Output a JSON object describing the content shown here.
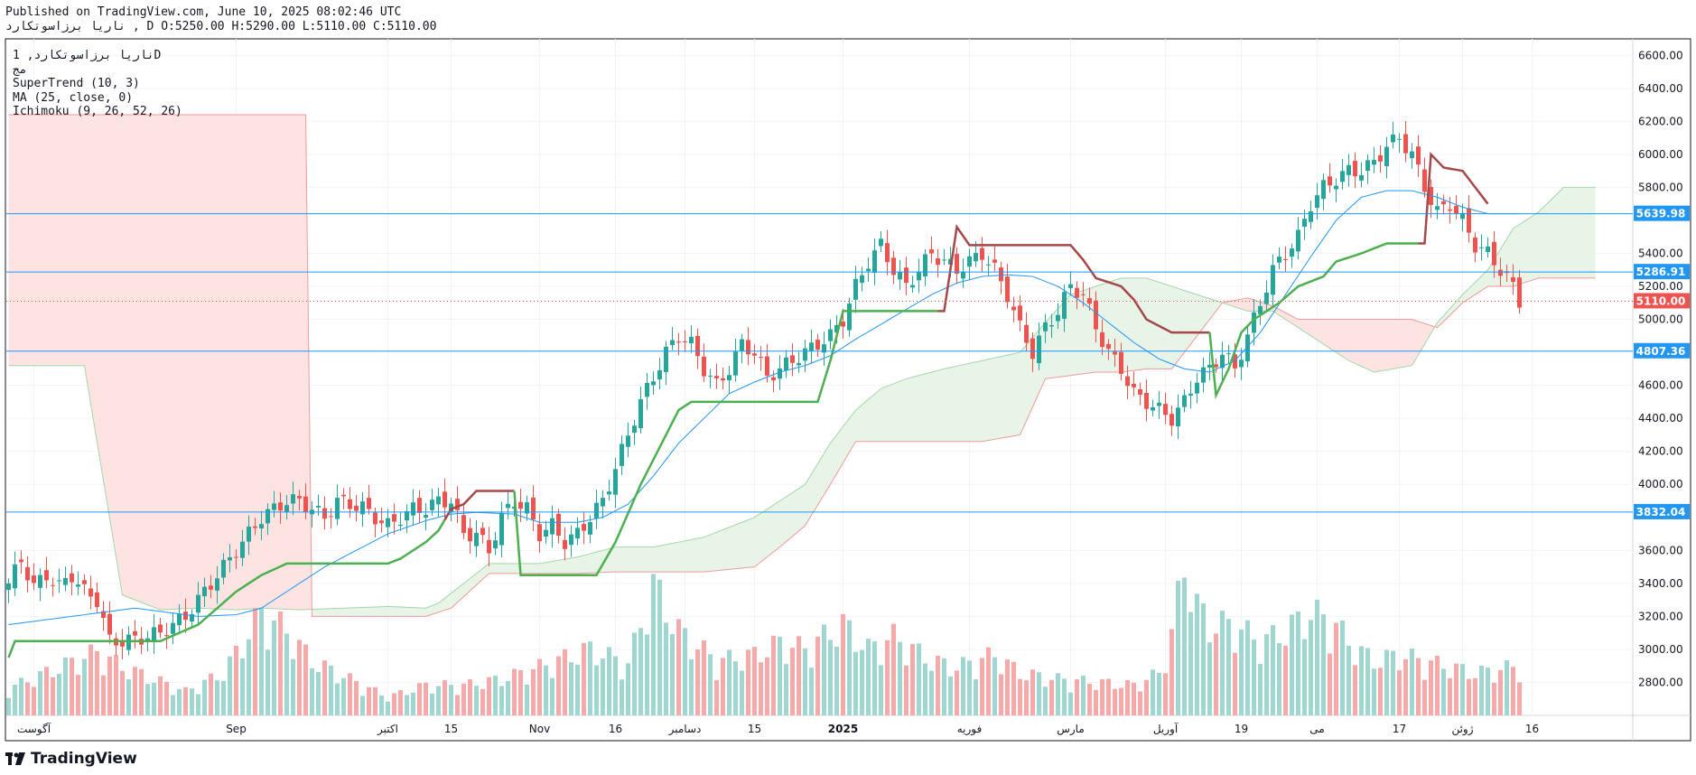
{
  "header": {
    "published": "Published on TradingView.com, June 10, 2025 08:02:46 UTC",
    "ohlc": "ناریا برزاسوتکارد , D O:5250.00 H:5290.00 L:5110.00 C:5110.00"
  },
  "legend": {
    "symbol_line": "ناریا برزاسوتکارد, 1D",
    "line2": "مج",
    "supertrend": "SuperTrend (10, 3)",
    "ma": "MA (25, close, 0)",
    "ichimoku": "Ichimoku (9, 26, 52, 26)"
  },
  "footer": {
    "brand": "TradingView"
  },
  "colors": {
    "up": "#26a69a",
    "down": "#ef5350",
    "vol_up": "#9fd6cf",
    "vol_down": "#f6a9a9",
    "supertrend_up": "#4caf50",
    "supertrend_down": "#a54849",
    "ma": "#2196f3",
    "cloud_bull": "#e7f4e7",
    "cloud_bear": "#fde4e3",
    "hline": "#2196f3",
    "grid": "#f0f3fa"
  },
  "chart_data": {
    "type": "candlestick",
    "ylim": [
      2600,
      6700
    ],
    "y_ticks": [
      "6600.00",
      "6400.00",
      "6200.00",
      "6000.00",
      "5800.00",
      "5400.00",
      "5200.00",
      "5000.00",
      "4600.00",
      "4400.00",
      "4200.00",
      "4000.00",
      "3600.00",
      "3400.00",
      "3200.00",
      "3000.00",
      "2800.00"
    ],
    "x_labels": [
      "آگوست",
      "Sep",
      "اکتبر",
      "15",
      "Nov",
      "16",
      "دسامبر",
      "15",
      "2025",
      "فوریه",
      "مارس",
      "آوریل",
      "19",
      "می",
      "17",
      "ژوئن",
      "16"
    ],
    "x_label_idx": [
      4,
      36,
      60,
      70,
      84,
      96,
      107,
      118,
      132,
      152,
      168,
      183,
      195,
      207,
      220,
      230,
      241
    ],
    "h_levels": [
      {
        "value": 5639.98,
        "label": "5639.98"
      },
      {
        "value": 5286.91,
        "label": "5286.91"
      },
      {
        "value": 4807.36,
        "label": "4807.36"
      },
      {
        "value": 3832.04,
        "label": "3832.04"
      }
    ],
    "last_price": {
      "value": 5110.0,
      "label": "5110.00"
    },
    "anchors": [
      [
        0,
        3400
      ],
      [
        2,
        3540
      ],
      [
        4,
        3380
      ],
      [
        6,
        3450
      ],
      [
        8,
        3380
      ],
      [
        10,
        3450
      ],
      [
        12,
        3350
      ],
      [
        14,
        3300
      ],
      [
        16,
        3050
      ],
      [
        18,
        3050
      ],
      [
        20,
        3060
      ],
      [
        22,
        3080
      ],
      [
        24,
        3100
      ],
      [
        26,
        3150
      ],
      [
        28,
        3200
      ],
      [
        30,
        3300
      ],
      [
        32,
        3400
      ],
      [
        34,
        3500
      ],
      [
        36,
        3600
      ],
      [
        38,
        3700
      ],
      [
        40,
        3800
      ],
      [
        42,
        3850
      ],
      [
        44,
        3900
      ],
      [
        46,
        3900
      ],
      [
        48,
        3850
      ],
      [
        50,
        3800
      ],
      [
        52,
        3900
      ],
      [
        54,
        3880
      ],
      [
        56,
        3860
      ],
      [
        58,
        3800
      ],
      [
        60,
        3750
      ],
      [
        62,
        3800
      ],
      [
        64,
        3850
      ],
      [
        66,
        3850
      ],
      [
        68,
        3900
      ],
      [
        70,
        3900
      ],
      [
        72,
        3700
      ],
      [
        74,
        3700
      ],
      [
        76,
        3600
      ],
      [
        78,
        3800
      ],
      [
        80,
        3900
      ],
      [
        82,
        3850
      ],
      [
        84,
        3700
      ],
      [
        86,
        3750
      ],
      [
        88,
        3650
      ],
      [
        90,
        3700
      ],
      [
        92,
        3800
      ],
      [
        94,
        3900
      ],
      [
        96,
        4100
      ],
      [
        98,
        4300
      ],
      [
        100,
        4500
      ],
      [
        102,
        4650
      ],
      [
        104,
        4800
      ],
      [
        106,
        4900
      ],
      [
        108,
        4850
      ],
      [
        110,
        4700
      ],
      [
        112,
        4600
      ],
      [
        114,
        4700
      ],
      [
        116,
        4850
      ],
      [
        118,
        4800
      ],
      [
        120,
        4650
      ],
      [
        122,
        4700
      ],
      [
        124,
        4750
      ],
      [
        126,
        4800
      ],
      [
        128,
        4850
      ],
      [
        130,
        4900
      ],
      [
        132,
        5000
      ],
      [
        134,
        5200
      ],
      [
        136,
        5350
      ],
      [
        138,
        5450
      ],
      [
        140,
        5300
      ],
      [
        142,
        5200
      ],
      [
        144,
        5300
      ],
      [
        146,
        5400
      ],
      [
        148,
        5350
      ],
      [
        150,
        5300
      ],
      [
        152,
        5350
      ],
      [
        154,
        5400
      ],
      [
        156,
        5300
      ],
      [
        158,
        5150
      ],
      [
        160,
        4950
      ],
      [
        162,
        4800
      ],
      [
        164,
        4950
      ],
      [
        166,
        5050
      ],
      [
        168,
        5200
      ],
      [
        170,
        5150
      ],
      [
        172,
        4950
      ],
      [
        174,
        4800
      ],
      [
        176,
        4700
      ],
      [
        178,
        4550
      ],
      [
        180,
        4500
      ],
      [
        182,
        4450
      ],
      [
        184,
        4400
      ],
      [
        186,
        4500
      ],
      [
        188,
        4650
      ],
      [
        190,
        4700
      ],
      [
        192,
        4800
      ],
      [
        194,
        4700
      ],
      [
        196,
        4900
      ],
      [
        198,
        5100
      ],
      [
        200,
        5300
      ],
      [
        202,
        5400
      ],
      [
        204,
        5500
      ],
      [
        206,
        5700
      ],
      [
        208,
        5800
      ],
      [
        210,
        5850
      ],
      [
        212,
        5900
      ],
      [
        214,
        5900
      ],
      [
        216,
        5950
      ],
      [
        218,
        6050
      ],
      [
        220,
        6100
      ],
      [
        222,
        6000
      ],
      [
        224,
        5800
      ],
      [
        226,
        5650
      ],
      [
        228,
        5700
      ],
      [
        230,
        5600
      ],
      [
        232,
        5450
      ],
      [
        234,
        5400
      ],
      [
        236,
        5300
      ],
      [
        238,
        5200
      ],
      [
        239,
        5110
      ]
    ],
    "supertrend": [
      [
        0,
        2950
      ],
      [
        1,
        3050
      ],
      [
        12,
        3050
      ],
      [
        24,
        3050
      ],
      [
        30,
        3150
      ],
      [
        36,
        3350
      ],
      [
        40,
        3450
      ],
      [
        44,
        3520
      ],
      [
        56,
        3520
      ],
      [
        60,
        3520
      ],
      [
        62,
        3550
      ],
      [
        66,
        3650
      ],
      [
        68,
        3720
      ],
      [
        70,
        3850
      ],
      [
        72,
        3880
      ],
      [
        74,
        3960
      ],
      [
        80,
        3960
      ],
      [
        81,
        3450
      ],
      [
        93,
        3450
      ],
      [
        96,
        3650
      ],
      [
        100,
        4000
      ],
      [
        104,
        4300
      ],
      [
        106,
        4450
      ],
      [
        108,
        4500
      ],
      [
        128,
        4500
      ],
      [
        130,
        4750
      ],
      [
        132,
        5050
      ],
      [
        148,
        5050
      ],
      [
        150,
        5560
      ],
      [
        152,
        5450
      ],
      [
        160,
        5450
      ],
      [
        166,
        5450
      ],
      [
        168,
        5450
      ],
      [
        170,
        5360
      ],
      [
        172,
        5250
      ],
      [
        176,
        5200
      ],
      [
        178,
        5120
      ],
      [
        180,
        5000
      ],
      [
        184,
        4920
      ],
      [
        186,
        4920
      ],
      [
        188,
        4920
      ],
      [
        190,
        4920
      ],
      [
        191,
        4540
      ],
      [
        193,
        4700
      ],
      [
        195,
        4920
      ],
      [
        197,
        5000
      ],
      [
        201,
        5100
      ],
      [
        204,
        5200
      ],
      [
        208,
        5260
      ],
      [
        210,
        5350
      ],
      [
        214,
        5400
      ],
      [
        218,
        5460
      ],
      [
        223,
        5460
      ],
      [
        224,
        5460
      ],
      [
        225,
        6000
      ],
      [
        227,
        5920
      ],
      [
        230,
        5900
      ],
      [
        232,
        5800
      ],
      [
        234,
        5700
      ]
    ],
    "ma": [
      [
        0,
        3150
      ],
      [
        10,
        3200
      ],
      [
        20,
        3250
      ],
      [
        30,
        3200
      ],
      [
        36,
        3210
      ],
      [
        40,
        3250
      ],
      [
        44,
        3350
      ],
      [
        50,
        3500
      ],
      [
        56,
        3620
      ],
      [
        60,
        3700
      ],
      [
        66,
        3780
      ],
      [
        70,
        3820
      ],
      [
        74,
        3830
      ],
      [
        80,
        3820
      ],
      [
        84,
        3770
      ],
      [
        90,
        3770
      ],
      [
        94,
        3800
      ],
      [
        98,
        3880
      ],
      [
        102,
        4050
      ],
      [
        106,
        4250
      ],
      [
        110,
        4400
      ],
      [
        114,
        4550
      ],
      [
        118,
        4620
      ],
      [
        122,
        4680
      ],
      [
        126,
        4720
      ],
      [
        130,
        4780
      ],
      [
        134,
        4880
      ],
      [
        138,
        4970
      ],
      [
        142,
        5060
      ],
      [
        146,
        5150
      ],
      [
        150,
        5220
      ],
      [
        154,
        5260
      ],
      [
        158,
        5270
      ],
      [
        162,
        5260
      ],
      [
        166,
        5200
      ],
      [
        170,
        5100
      ],
      [
        174,
        4980
      ],
      [
        178,
        4860
      ],
      [
        182,
        4760
      ],
      [
        186,
        4700
      ],
      [
        190,
        4680
      ],
      [
        194,
        4750
      ],
      [
        198,
        4920
      ],
      [
        202,
        5150
      ],
      [
        206,
        5380
      ],
      [
        210,
        5600
      ],
      [
        214,
        5740
      ],
      [
        218,
        5780
      ],
      [
        222,
        5780
      ],
      [
        226,
        5740
      ],
      [
        230,
        5680
      ],
      [
        234,
        5640
      ]
    ],
    "cloud_a": [
      [
        0,
        4720
      ],
      [
        12,
        4720
      ],
      [
        18,
        3330
      ],
      [
        24,
        3240
      ],
      [
        30,
        3250
      ],
      [
        36,
        3240
      ],
      [
        40,
        3250
      ],
      [
        46,
        3240
      ],
      [
        60,
        3260
      ],
      [
        66,
        3250
      ],
      [
        68,
        3280
      ],
      [
        72,
        3400
      ],
      [
        76,
        3520
      ],
      [
        84,
        3520
      ],
      [
        90,
        3560
      ],
      [
        96,
        3620
      ],
      [
        102,
        3620
      ],
      [
        110,
        3680
      ],
      [
        118,
        3800
      ],
      [
        122,
        3900
      ],
      [
        126,
        4000
      ],
      [
        130,
        4250
      ],
      [
        134,
        4450
      ],
      [
        138,
        4580
      ],
      [
        142,
        4640
      ],
      [
        148,
        4700
      ],
      [
        154,
        4750
      ],
      [
        160,
        4800
      ],
      [
        164,
        4980
      ],
      [
        168,
        5150
      ],
      [
        172,
        5200
      ],
      [
        176,
        5250
      ],
      [
        180,
        5250
      ],
      [
        184,
        5200
      ],
      [
        188,
        5150
      ],
      [
        192,
        5100
      ],
      [
        196,
        5050
      ],
      [
        200,
        5050
      ],
      [
        204,
        4950
      ],
      [
        208,
        4850
      ],
      [
        212,
        4750
      ],
      [
        216,
        4680
      ],
      [
        222,
        4720
      ],
      [
        226,
        4980
      ],
      [
        230,
        5150
      ],
      [
        234,
        5300
      ],
      [
        238,
        5550
      ],
      [
        242,
        5650
      ],
      [
        246,
        5800
      ],
      [
        250,
        5800
      ]
    ],
    "cloud_b": [
      [
        0,
        6240
      ],
      [
        47,
        6240
      ],
      [
        48,
        3200
      ],
      [
        54,
        3200
      ],
      [
        60,
        3200
      ],
      [
        66,
        3200
      ],
      [
        70,
        3250
      ],
      [
        76,
        3460
      ],
      [
        84,
        3460
      ],
      [
        90,
        3460
      ],
      [
        96,
        3470
      ],
      [
        102,
        3470
      ],
      [
        110,
        3470
      ],
      [
        118,
        3500
      ],
      [
        122,
        3620
      ],
      [
        126,
        3750
      ],
      [
        130,
        4000
      ],
      [
        134,
        4260
      ],
      [
        138,
        4260
      ],
      [
        148,
        4260
      ],
      [
        154,
        4260
      ],
      [
        160,
        4300
      ],
      [
        164,
        4640
      ],
      [
        168,
        4660
      ],
      [
        172,
        4680
      ],
      [
        176,
        4680
      ],
      [
        180,
        4700
      ],
      [
        184,
        4700
      ],
      [
        188,
        4900
      ],
      [
        192,
        5100
      ],
      [
        196,
        5130
      ],
      [
        200,
        5080
      ],
      [
        204,
        5000
      ],
      [
        208,
        5000
      ],
      [
        212,
        5000
      ],
      [
        216,
        5000
      ],
      [
        222,
        5000
      ],
      [
        226,
        4950
      ],
      [
        230,
        5100
      ],
      [
        234,
        5200
      ],
      [
        238,
        5200
      ],
      [
        242,
        5250
      ],
      [
        246,
        5250
      ],
      [
        250,
        5250
      ]
    ],
    "volume_peaks": [
      [
        0,
        45
      ],
      [
        14,
        105
      ],
      [
        18,
        80
      ],
      [
        28,
        40
      ],
      [
        34,
        70
      ],
      [
        40,
        170
      ],
      [
        44,
        140
      ],
      [
        48,
        90
      ],
      [
        60,
        30
      ],
      [
        66,
        50
      ],
      [
        72,
        50
      ],
      [
        78,
        60
      ],
      [
        84,
        80
      ],
      [
        92,
        110
      ],
      [
        98,
        85
      ],
      [
        102,
        215
      ],
      [
        106,
        140
      ],
      [
        112,
        90
      ],
      [
        118,
        100
      ],
      [
        122,
        120
      ],
      [
        126,
        110
      ],
      [
        132,
        150
      ],
      [
        136,
        110
      ],
      [
        140,
        130
      ],
      [
        146,
        90
      ],
      [
        150,
        80
      ],
      [
        156,
        100
      ],
      [
        160,
        70
      ],
      [
        166,
        60
      ],
      [
        172,
        55
      ],
      [
        178,
        50
      ],
      [
        182,
        70
      ],
      [
        184,
        135
      ],
      [
        186,
        250
      ],
      [
        188,
        180
      ],
      [
        190,
        150
      ],
      [
        194,
        150
      ],
      [
        198,
        120
      ],
      [
        202,
        140
      ],
      [
        206,
        170
      ],
      [
        210,
        150
      ],
      [
        212,
        120
      ],
      [
        216,
        90
      ],
      [
        220,
        100
      ],
      [
        224,
        90
      ],
      [
        228,
        80
      ],
      [
        232,
        70
      ],
      [
        238,
        80
      ]
    ],
    "volume_max": 3620
  }
}
